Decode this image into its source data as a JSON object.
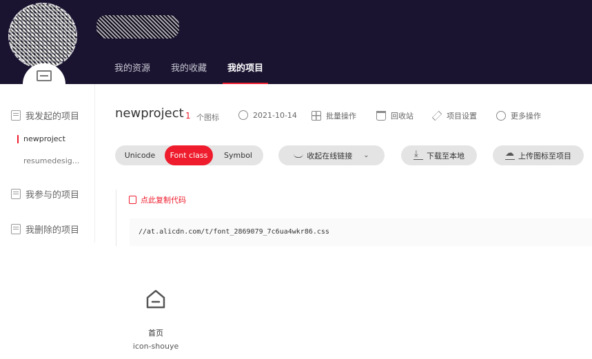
{
  "header": {
    "nav": [
      {
        "label": "我的资源"
      },
      {
        "label": "我的收藏"
      },
      {
        "label": "我的项目",
        "active": true
      }
    ]
  },
  "sidebar": {
    "initiated": "我发起的项目",
    "projects": [
      "newproject",
      "resumedesig..."
    ],
    "participated": "我参与的项目",
    "deleted": "我删除的项目"
  },
  "project": {
    "name": "newproject",
    "count": "1",
    "count_label": "个图标",
    "date": "2021-10-14",
    "actions": [
      "批量操作",
      "回收站",
      "项目设置",
      "更多操作"
    ]
  },
  "tabs": [
    "Unicode",
    "Font class",
    "Symbol"
  ],
  "active_tab": "Font class",
  "buttons": {
    "online_link": "收起在线链接",
    "download": "下载至本地",
    "upload": "上传图标至项目"
  },
  "code": {
    "copy_label": "点此复制代码",
    "url": "//at.alicdn.com/t/font_2869079_7c6ua4wkr86.css"
  },
  "icons": [
    {
      "name": "首页",
      "class": "icon-shouye"
    }
  ],
  "colors": {
    "header_bg": "#1b1431",
    "accent": "#ee1c2c"
  }
}
